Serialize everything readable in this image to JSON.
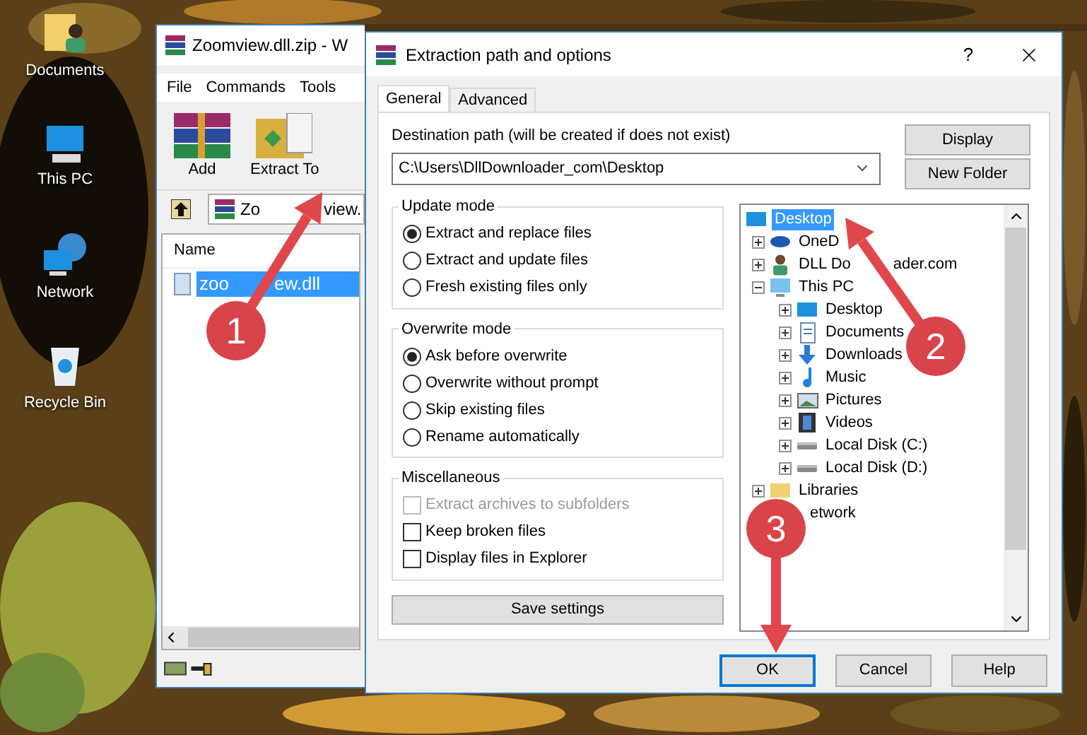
{
  "desktop": {
    "icons": [
      {
        "label": "Documents",
        "kind": "user-folder"
      },
      {
        "label": "This PC",
        "kind": "pc"
      },
      {
        "label": "Network",
        "kind": "network"
      },
      {
        "label": "Recycle Bin",
        "kind": "bin"
      }
    ]
  },
  "archive_window": {
    "title": "Zoomview.dll.zip - W",
    "menu": [
      "File",
      "Commands",
      "Tools"
    ],
    "toolbar": [
      {
        "label": "Add",
        "kind": "add"
      },
      {
        "label": "Extract To",
        "kind": "extract"
      }
    ],
    "address": [
      "Zo",
      "view."
    ],
    "columns": [
      "Name"
    ],
    "rows": [
      {
        "name": [
          "zoo",
          "ew.dll"
        ],
        "selected": true
      }
    ]
  },
  "dialog": {
    "title": "Extraction path and options",
    "help": "?",
    "tabs": [
      {
        "label": "General",
        "selected": true
      },
      {
        "label": "Advanced",
        "selected": false
      }
    ],
    "destination_label": "Destination path (will be created if does not exist)",
    "destination_value": "C:\\Users\\DllDownloader_com\\Desktop",
    "side_buttons": [
      "Display",
      "New Folder"
    ],
    "groups": [
      {
        "title": "Update mode",
        "options": [
          {
            "kind": "radio",
            "label": "Extract and replace files",
            "selected": true,
            "disabled": false
          },
          {
            "kind": "radio",
            "label": "Extract and update files",
            "selected": false,
            "disabled": false
          },
          {
            "kind": "radio",
            "label": "Fresh existing files only",
            "selected": false,
            "disabled": false
          }
        ]
      },
      {
        "title": "Overwrite mode",
        "options": [
          {
            "kind": "radio",
            "label": "Ask before overwrite",
            "selected": true,
            "disabled": false
          },
          {
            "kind": "radio",
            "label": "Overwrite without prompt",
            "selected": false,
            "disabled": false
          },
          {
            "kind": "radio",
            "label": "Skip existing files",
            "selected": false,
            "disabled": false
          },
          {
            "kind": "radio",
            "label": "Rename automatically",
            "selected": false,
            "disabled": false
          }
        ]
      },
      {
        "title": "Miscellaneous",
        "options": [
          {
            "kind": "checkbox",
            "label": "Extract archives to subfolders",
            "checked": false,
            "disabled": true
          },
          {
            "kind": "checkbox",
            "label": "Keep broken files",
            "checked": false,
            "disabled": false
          },
          {
            "kind": "checkbox",
            "label": "Display files in Explorer",
            "checked": false,
            "disabled": false
          }
        ]
      }
    ],
    "save_button": "Save settings",
    "tree": [
      {
        "label": [
          "Desktop"
        ],
        "kind": "desktop",
        "selected": true,
        "children": [
          {
            "label": [
              "OneD"
            ],
            "kind": "cloud",
            "selected": false,
            "expanded": false
          },
          {
            "label": [
              "DLL Do",
              "ader.com"
            ],
            "kind": "user",
            "selected": false,
            "expanded": false
          },
          {
            "label": [
              "This PC"
            ],
            "kind": "pc",
            "selected": false,
            "expanded": true,
            "children": [
              {
                "label": [
                  "Desktop"
                ],
                "kind": "desktop",
                "selected": false,
                "expanded": false
              },
              {
                "label": [
                  "Documents"
                ],
                "kind": "documents",
                "selected": false,
                "expanded": false
              },
              {
                "label": [
                  "Downloads"
                ],
                "kind": "downloads",
                "selected": false,
                "expanded": false
              },
              {
                "label": [
                  "Music"
                ],
                "kind": "music",
                "selected": false,
                "expanded": false
              },
              {
                "label": [
                  "Pictures"
                ],
                "kind": "pictures",
                "selected": false,
                "expanded": false
              },
              {
                "label": [
                  "Videos"
                ],
                "kind": "videos",
                "selected": false,
                "expanded": false
              },
              {
                "label": [
                  "Local Disk (C:)"
                ],
                "kind": "drive",
                "selected": false,
                "expanded": false
              },
              {
                "label": [
                  "Local Disk (D:)"
                ],
                "kind": "drive",
                "selected": false,
                "expanded": false
              }
            ]
          },
          {
            "label": [
              "Libraries"
            ],
            "kind": "library",
            "selected": false,
            "expanded": false
          },
          {
            "label": [
              "etwork"
            ],
            "selected": false
          }
        ]
      }
    ],
    "footer_buttons": [
      {
        "label": "OK",
        "default": true
      },
      {
        "label": "Cancel",
        "default": false
      },
      {
        "label": "Help",
        "default": false
      }
    ]
  },
  "annotations": [
    {
      "label": "1"
    },
    {
      "label": "2"
    },
    {
      "label": "3"
    }
  ]
}
